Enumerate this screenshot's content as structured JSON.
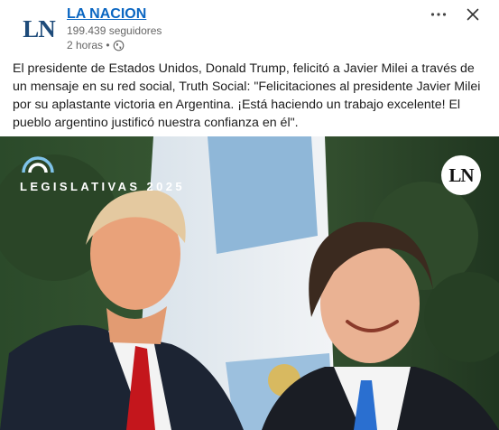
{
  "post": {
    "author": {
      "logo_text": "LN",
      "name": "LA NACION",
      "followers": "199.439 seguidores",
      "time": "2 horas •"
    },
    "menu_glyph": "···",
    "close_glyph": "✕",
    "body": "El presidente de Estados Unidos, Donald Trump, felicitó a Javier Milei a través de un mensaje en su red social, Truth Social: \"Felicitaciones al presidente Javier Milei por su aplastante victoria en Argentina. ¡Está haciendo un trabajo excelente! El pueblo argentino justificó nuestra confianza en él\".",
    "image": {
      "overlay_label": "LEGISLATIVAS 2025",
      "badge_text": "LN"
    }
  },
  "colors": {
    "link": "#0a66c2",
    "brand_blue": "#1e4b7a",
    "muted": "#666666"
  },
  "icons": [
    "logo",
    "ellipsis-icon",
    "close-icon",
    "globe-icon",
    "sun-logo-icon"
  ]
}
